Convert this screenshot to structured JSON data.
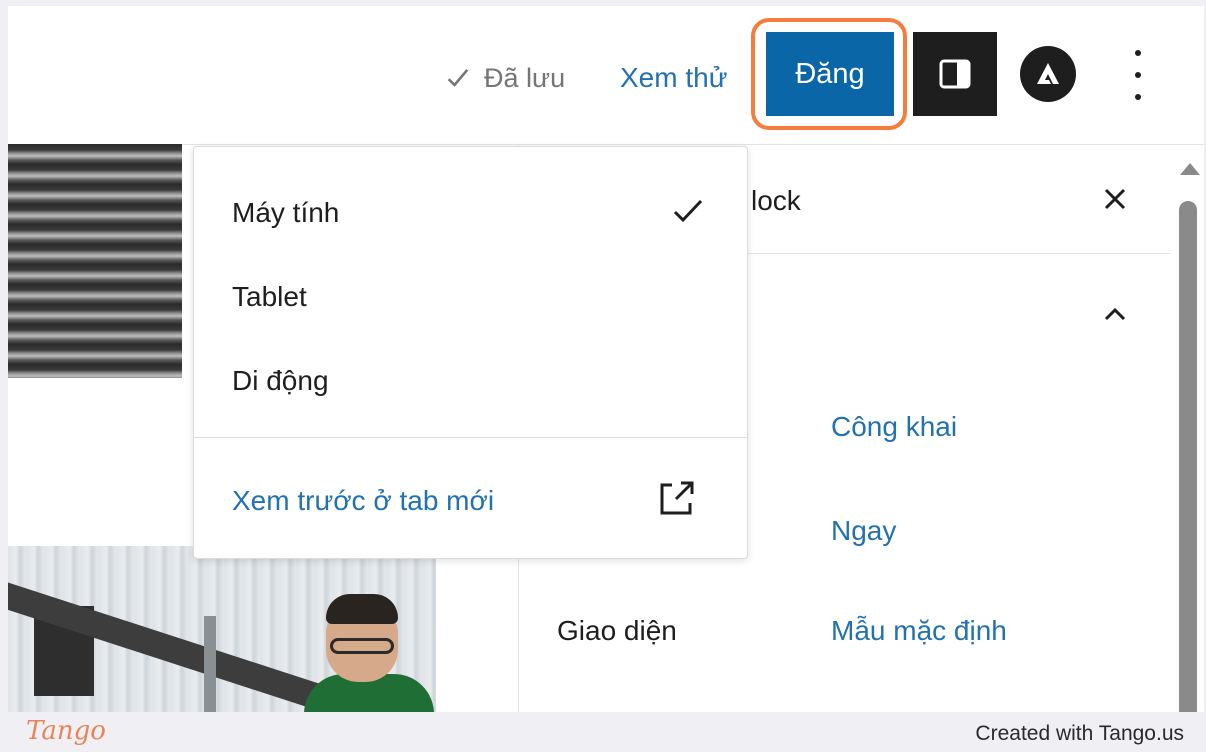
{
  "toolbar": {
    "saved_label": "Đã lưu",
    "preview_label": "Xem thử",
    "publish_label": "Đăng",
    "settings_icon": "sidebar-toggle-icon",
    "plugin_icon": "astra-logo-icon",
    "more_icon": "more-vertical-icon"
  },
  "dropdown": {
    "items": [
      {
        "label": "Máy tính",
        "selected": true
      },
      {
        "label": "Tablet",
        "selected": false
      },
      {
        "label": "Di động",
        "selected": false
      }
    ],
    "new_tab_label": "Xem trước ở tab mới"
  },
  "sidebar": {
    "header_partial": "lock",
    "rows": [
      {
        "label": "",
        "value": "Công khai"
      },
      {
        "label": "",
        "value": "Ngay"
      },
      {
        "label": "Giao diện",
        "value": "Mẫu mặc định"
      }
    ]
  },
  "footer": {
    "brand": "Tango",
    "credit": "Created with Tango.us"
  },
  "colors": {
    "accent": "#2271b1",
    "publish_bg": "#0b66a8",
    "highlight_ring": "#f57c3a"
  }
}
